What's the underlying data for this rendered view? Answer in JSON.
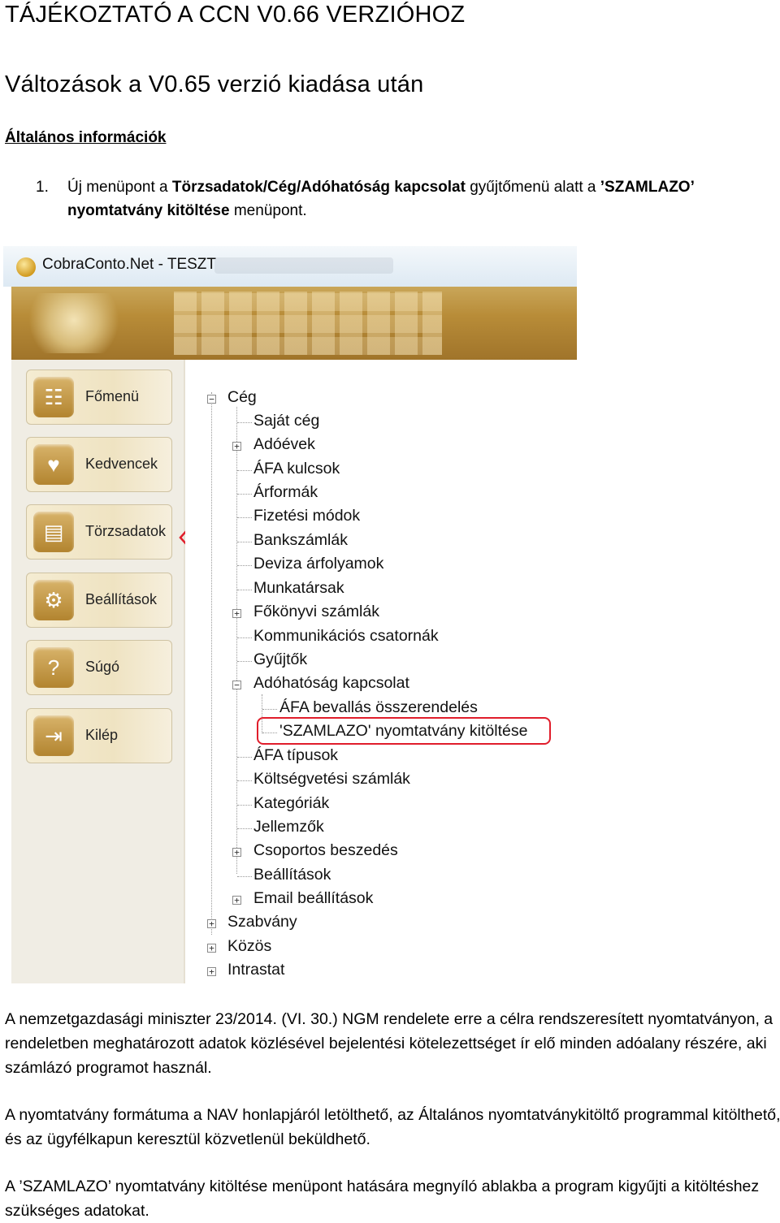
{
  "doc": {
    "title": "TÁJÉKOZTATÓ A CCN V0.66 VERZIÓHOZ",
    "subtitle": "Változások a V0.65 verzió kiadása után",
    "section": "Általános információk",
    "item1": {
      "number": "1.",
      "p1": "Új menüpont a ",
      "b1": "Törzsadatok/Cég/Adóhatóság kapcsolat",
      "p2": " gyűjtőmenü alatt a ",
      "b2": "’SZAMLAZO’ nyomtatvány kitöltése",
      "p3": " menüpont."
    },
    "para1": "A nemzetgazdasági miniszter 23/2014. (VI. 30.) NGM rendelete erre a célra rendszeresített nyomtatványon, a rendeletben meghatározott adatok közlésével bejelentési kötelezettséget ír elő minden adóalany részére, aki számlázó programot használ.",
    "para2": "A nyomtatvány formátuma a NAV honlapjáról letölthető, az Általános nyomtatványkitöltő programmal kitölthető, és az ügyfélkapun keresztül közvetlenül beküldhető.",
    "para3": "A ’SZAMLAZO’ nyomtatvány kitöltése menüpont hatására megnyíló ablakba a program kigyűjti a kitöltéshez szükséges adatokat."
  },
  "screenshot": {
    "window_title": "CobraConto.Net - TESZT",
    "nav": [
      {
        "label": "Főmenü",
        "icon": "tree-menu-icon"
      },
      {
        "label": "Kedvencek",
        "icon": "heart-icon"
      },
      {
        "label": "Törzsadatok",
        "icon": "document-icon"
      },
      {
        "label": "Beállítások",
        "icon": "gear-icon"
      },
      {
        "label": "Súgó",
        "icon": "question-icon"
      },
      {
        "label": "Kilép",
        "icon": "exit-icon"
      }
    ],
    "tree": {
      "root": "Cég",
      "children": [
        "Saját cég",
        "Adóévek",
        "ÁFA kulcsok",
        "Árformák",
        "Fizetési módok",
        "Bankszámlák",
        "Deviza árfolyamok",
        "Munkatársak",
        "Főkönyvi számlák",
        "Kommunikációs csatornák",
        "Gyűjtők",
        "Adóhatóság kapcsolat"
      ],
      "adohatosag_children": [
        "ÁFA bevallás összerendelés",
        "'SZAMLAZO' nyomtatvány kitöltése"
      ],
      "more_children": [
        "ÁFA típusok",
        "Költségvetési számlák",
        "Kategóriák",
        "Jellemzők",
        "Csoportos beszedés",
        "Beállítások",
        "Email beállítások"
      ],
      "top_level": [
        "Szabvány",
        "Közös",
        "Intrastat"
      ]
    },
    "highlight_color": "#e01d2b"
  }
}
